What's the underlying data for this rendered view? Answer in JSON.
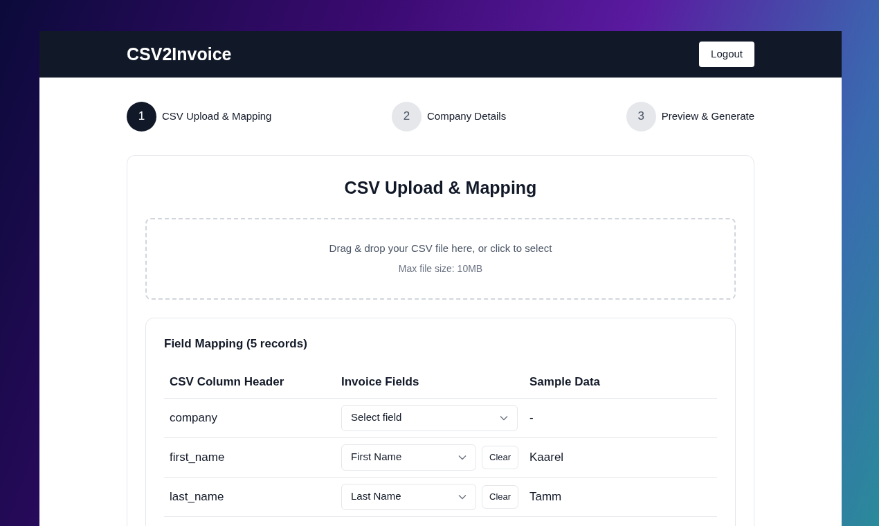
{
  "header": {
    "logo": "CSV2Invoice",
    "logout": "Logout"
  },
  "steps": [
    {
      "number": "1",
      "label": "CSV Upload & Mapping",
      "selected": true
    },
    {
      "number": "2",
      "label": "Company Details",
      "selected": false
    },
    {
      "number": "3",
      "label": "Preview & Generate",
      "selected": false
    }
  ],
  "card": {
    "title": "CSV Upload & Mapping",
    "dropzone": {
      "text": "Drag & drop your CSV file here, or click to select",
      "hint": "Max file size: 10MB"
    },
    "mapping": {
      "title": "Field Mapping (5 records)",
      "columns": [
        "CSV Column Header",
        "Invoice Fields",
        "Sample Data"
      ],
      "rows": [
        {
          "column": "company",
          "field": {
            "placeholder": "Select field"
          },
          "sample": "-"
        },
        {
          "column": "first_name",
          "field": {
            "value": "First Name",
            "clear": "Clear"
          },
          "sample": "Kaarel"
        },
        {
          "column": "last_name",
          "field": {
            "value": "Last Name",
            "clear": "Clear"
          },
          "sample": "Tamm"
        }
      ]
    }
  }
}
